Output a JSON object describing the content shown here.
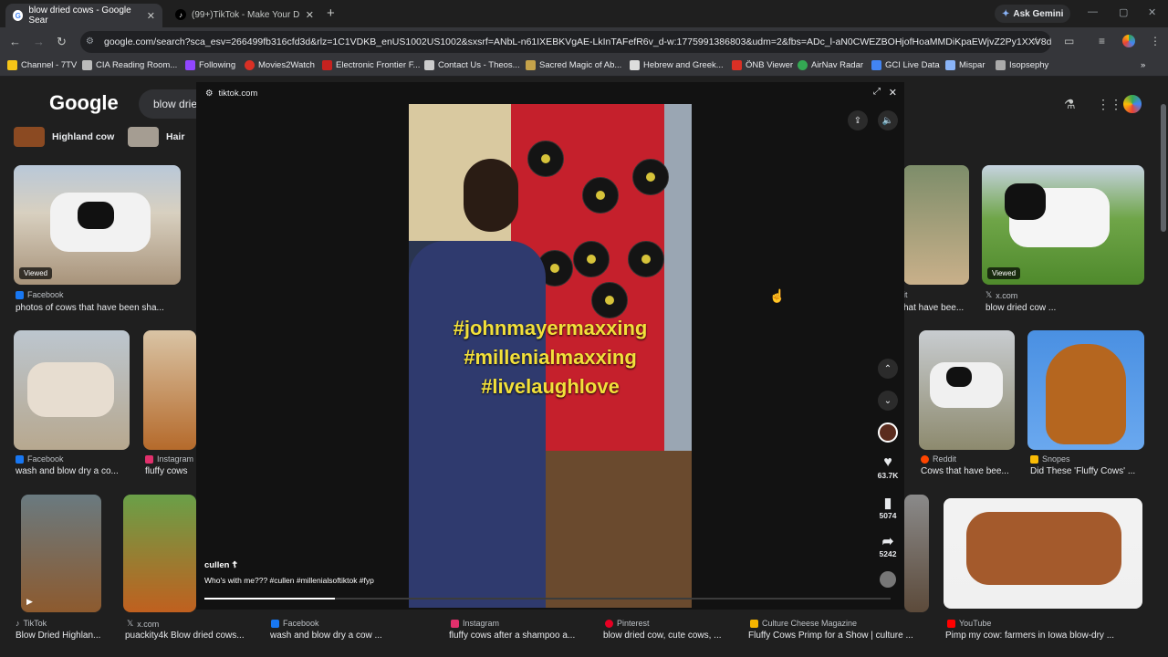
{
  "tabs": [
    {
      "title": "blow dried cows - Google Sear",
      "active": true
    },
    {
      "title": "(99+)TikTok - Make Your D",
      "active": false
    }
  ],
  "gemini_label": "Ask Gemini",
  "url": "google.com/search?sca_esv=266499fb316cfd3d&rlz=1C1VDKB_enUS1002US1002&sxsrf=ANbL-n61IXEBKVgAE-LkInTAFefR6v_d-w:1775991386803&udm=2&fbs=ADc_l-aN0CWEZBOHjofHoaMMDiKpaEWjvZ2Py1XXV8d8Kvil...",
  "bookmarks": [
    "Channel - 7TV",
    "CIA Reading Room...",
    "Following",
    "Movies2Watch",
    "Electronic Frontier F...",
    "Contact Us - Theos...",
    "Sacred Magic of Ab...",
    "Hebrew and Greek...",
    "ÖNB Viewer",
    "AirNav Radar",
    "GCI Live Data",
    "Mispar",
    "Isopsephy"
  ],
  "google": {
    "logo": "Google",
    "query": "blow drie",
    "chips": [
      "Highland cow",
      "Hair"
    ]
  },
  "results": {
    "r1": [
      {
        "source": "Facebook",
        "title": "photos of cows that have been sha...",
        "viewed": "Viewed"
      },
      {
        "source": "it",
        "title": "hat have bee..."
      },
      {
        "source": "x.com",
        "title": "blow dried cow ...",
        "viewed": "Viewed"
      }
    ],
    "r2": [
      {
        "source": "Facebook",
        "title": "wash and blow dry a co..."
      },
      {
        "source": "Instagram",
        "title": "fluffy cows"
      },
      {
        "source": "Reddit",
        "title": "Cows that have bee..."
      },
      {
        "source": "Snopes",
        "title": "Did These 'Fluffy Cows' ..."
      }
    ],
    "r3": [
      {
        "source": "TikTok",
        "title": "Blow Dried Highlan..."
      },
      {
        "source": "x.com",
        "title": "puackity4k Blow dried cows..."
      },
      {
        "source": "Facebook",
        "title": "wash and blow dry a cow ..."
      },
      {
        "source": "Instagram",
        "title": "fluffy cows after a shampoo a..."
      },
      {
        "source": "Pinterest",
        "title": "blow dried cow, cute cows, ..."
      },
      {
        "source": "Culture Cheese Magazine",
        "title": "Fluffy Cows Primp for a Show | culture ..."
      },
      {
        "source": "YouTube",
        "title": "Pimp my cow: farmers in Iowa blow-dry ..."
      }
    ]
  },
  "overlay": {
    "domain": "tiktok.com",
    "hashtags": [
      "#johnmayermaxxing",
      "#millenialmaxxing",
      "#livelaughlove"
    ],
    "likes": "63.7K",
    "saves": "5074",
    "shares": "5242",
    "author": "cullen ☦",
    "caption": "Who's with me??? #cullen #millenialsoftiktok #fyp",
    "progress": 0.19
  }
}
